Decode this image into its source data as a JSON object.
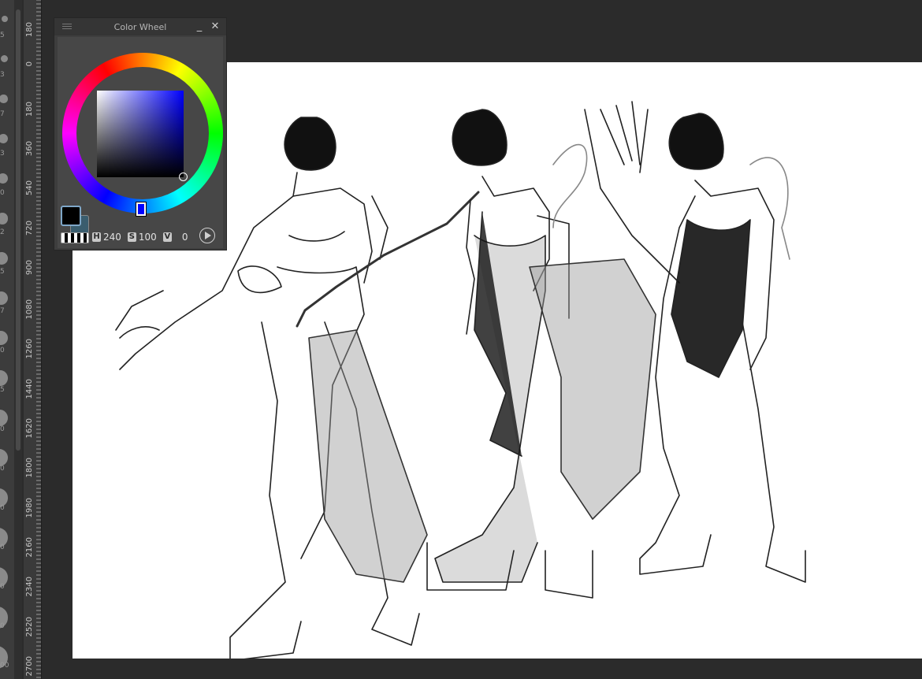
{
  "color_wheel": {
    "title": "Color Wheel",
    "min_icon": "_",
    "close_icon": "✕",
    "h_key": "H",
    "h_value": "240",
    "s_key": "S",
    "s_value": "100",
    "v_key": "V",
    "v_value": "0",
    "main_color": "#000000",
    "sub_color": "#3a5d6e",
    "hue_color": "#0000ff"
  },
  "ruler": {
    "labels": [
      "180",
      "0",
      "180",
      "360",
      "540",
      "720",
      "900",
      "1080",
      "1260",
      "1440",
      "1620",
      "1800",
      "1980",
      "2160",
      "2340",
      "2520",
      "2700"
    ]
  },
  "brush_strip": {
    "labels": [
      "5",
      "3",
      "7",
      "3",
      "0",
      "2",
      "5",
      "7",
      "0",
      "5",
      "0",
      "0",
      "0",
      "0",
      "0",
      "0",
      "00"
    ]
  },
  "canvas": {
    "background": "#ffffff",
    "content": "sketch-artwork"
  }
}
